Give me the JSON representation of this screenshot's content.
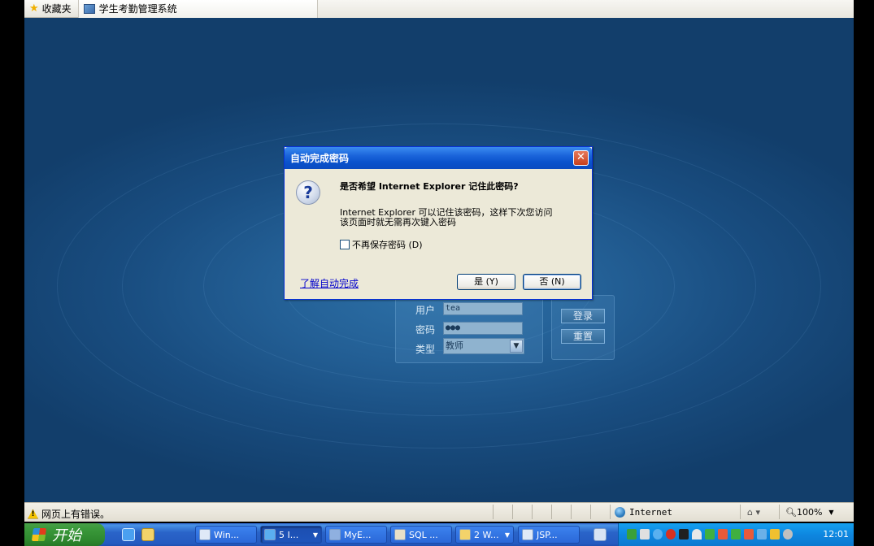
{
  "favbar": {
    "favorites_label": "收藏夹",
    "tab_title": "学生考勤管理系统"
  },
  "login": {
    "user_label": "用户",
    "user_value": "tea",
    "password_label": "密码",
    "password_value": "●●●",
    "type_label": "类型",
    "type_value": "教师",
    "login_button": "登录",
    "reset_button": "重置"
  },
  "dialog": {
    "title": "自动完成密码",
    "close_glyph": "✕",
    "question": "是否希望 Internet Explorer 记住此密码?",
    "message_line1": "Internet Explorer 可以记住该密码，这样下次您访问",
    "message_line2": "该页面时就无需再次键入密码",
    "checkbox_label": "不再保存密码 (D)",
    "link_label": "了解自动完成",
    "yes_button": "是 (Y)",
    "no_button": "否 (N)"
  },
  "statusbar": {
    "warning_text": "网页上有错误。",
    "zone_text": "Internet",
    "zoom_text": "100%"
  },
  "taskbar": {
    "start_label": "开始",
    "tasks": [
      {
        "label": "Win..."
      },
      {
        "label": "5 I..."
      },
      {
        "label": "MyE..."
      },
      {
        "label": "SQL ..."
      },
      {
        "label": "2 W..."
      },
      {
        "label": "JSP..."
      }
    ],
    "clock": "12:01"
  },
  "colors": {
    "page_bg": "#1f5a91",
    "dialog_title": "#0a52cc",
    "taskbar": "#245ac0",
    "start_green": "#3c9a3c",
    "tray": "#0e87e0"
  }
}
